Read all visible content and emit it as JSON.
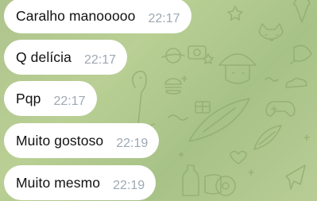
{
  "chat": {
    "background_color": "#b2c98f",
    "bubble_color": "#ffffff",
    "time_color": "#9ea8b2",
    "messages": [
      {
        "text": "Caralho manooooo",
        "time": "22:17"
      },
      {
        "text": "Q delícia",
        "time": "22:17"
      },
      {
        "text": "Pqp",
        "time": "22:17"
      },
      {
        "text": "Muito gostoso",
        "time": "22:19"
      },
      {
        "text": "Muito mesmo",
        "time": "22:19"
      }
    ]
  }
}
